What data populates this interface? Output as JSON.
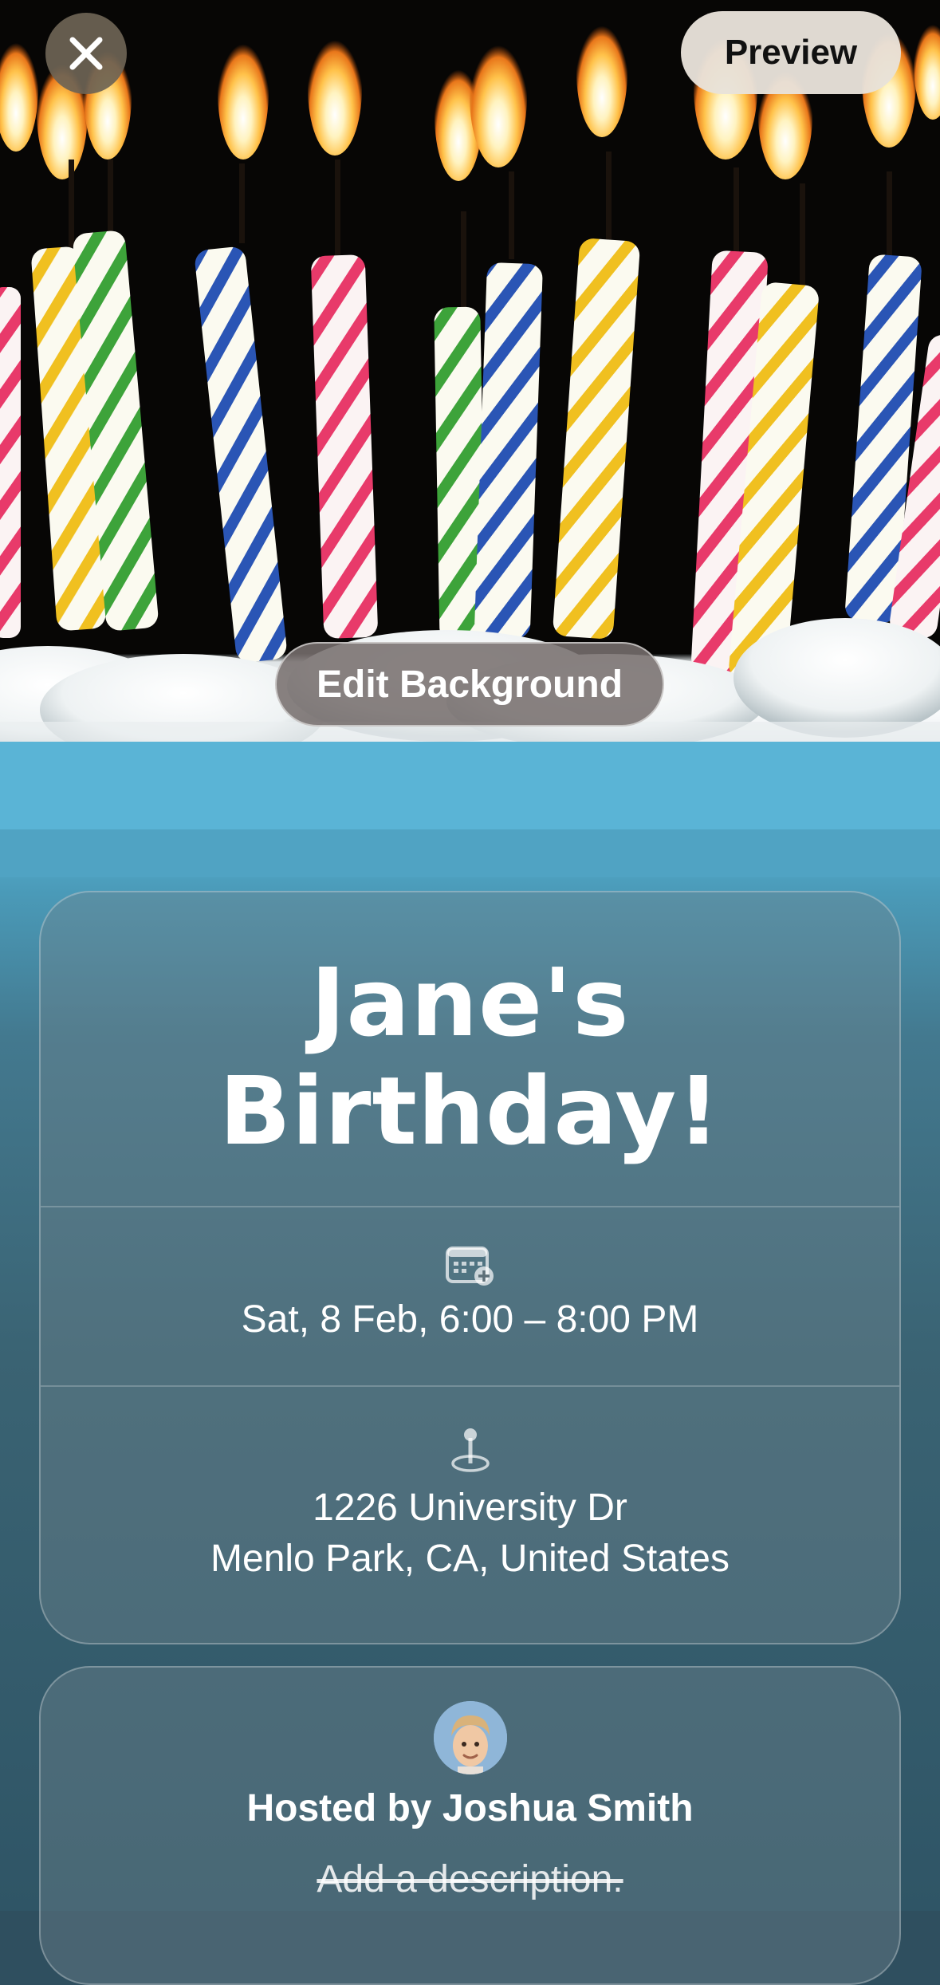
{
  "header": {
    "close_icon": "close-icon",
    "preview_label": "Preview"
  },
  "background": {
    "edit_label": "Edit Background"
  },
  "event": {
    "title_line1": "Jane's",
    "title_line2": "Birthday!",
    "date_icon": "calendar-add-icon",
    "date_time": "Sat, 8 Feb, 6:00 – 8:00 PM",
    "location_icon": "map-pin-icon",
    "address_line1": "1226 University Dr",
    "address_line2": "Menlo Park, CA, United States"
  },
  "host": {
    "avatar_icon": "memoji-avatar",
    "hosted_by": "Hosted by Joshua Smith",
    "description_placeholder": "Add a description."
  },
  "colors": {
    "card_fill": "#6e828c",
    "preview_button": "#e8e2da",
    "close_button": "#6e6455"
  }
}
